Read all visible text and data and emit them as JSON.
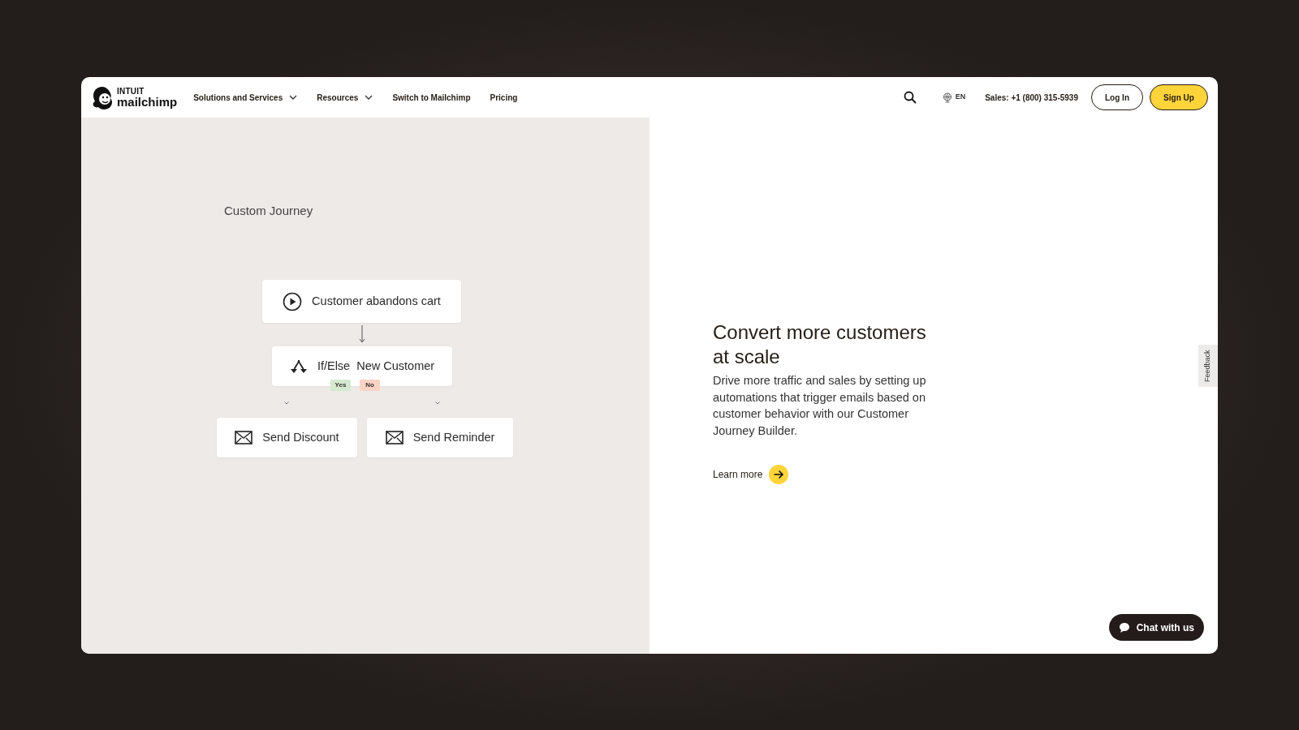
{
  "header": {
    "logo": {
      "brand_top": "INTUIT",
      "brand_bottom": "mailchimp"
    },
    "nav": [
      {
        "label": "Solutions and Services",
        "has_menu": true
      },
      {
        "label": "Resources",
        "has_menu": true
      },
      {
        "label": "Switch to Mailchimp",
        "has_menu": false
      },
      {
        "label": "Pricing",
        "has_menu": false
      }
    ],
    "language": "EN",
    "sales": "Sales: +1 (800) 315-5939",
    "login": "Log In",
    "signup": "Sign Up"
  },
  "diagram": {
    "title": "Custom Journey",
    "nodes": [
      {
        "kind": "trigger",
        "label": "Customer abandons cart"
      },
      {
        "kind": "condition",
        "label": "If/Else  New Customer",
        "branches": [
          {
            "label": "Yes",
            "color": "#d5e8d0"
          },
          {
            "label": "No",
            "color": "#fbd3c4"
          }
        ]
      },
      {
        "kind": "action",
        "label": "Send Discount"
      },
      {
        "kind": "action",
        "label": "Send Reminder"
      }
    ]
  },
  "feature": {
    "heading": "Convert more customers at scale",
    "body": "Drive more traffic and sales by setting up automations that trigger emails based on customer behavior with our Customer Journey Builder.",
    "link": "Learn more"
  },
  "feedback_tab": "Feedback",
  "chat_button": "Chat with us"
}
